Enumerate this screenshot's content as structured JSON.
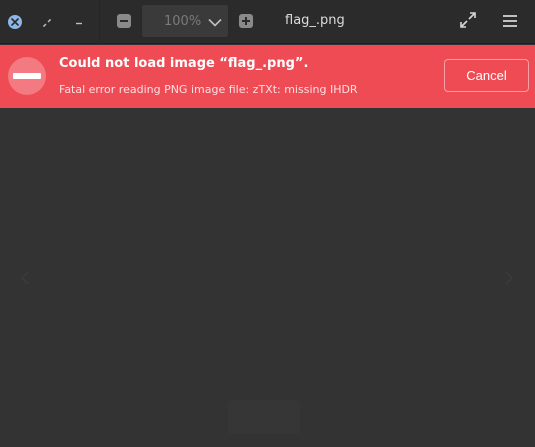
{
  "header": {
    "zoom_value": "100%",
    "title": "flag_.png"
  },
  "icons": {
    "close": "close-icon",
    "restore": "restore-icon",
    "minimize": "minimize-icon",
    "zoom_out": "zoom-out-icon",
    "zoom_dropdown": "chevron-down-icon",
    "zoom_in": "zoom-in-icon",
    "fullscreen": "fullscreen-icon",
    "menu": "hamburger-menu-icon",
    "error": "error-icon",
    "prev": "chevron-left-icon",
    "next": "chevron-right-icon"
  },
  "banner": {
    "title": "Could not load image “flag_.png”.",
    "detail": "Fatal error reading PNG image file: zTXt: missing IHDR",
    "cancel_label": "Cancel"
  },
  "colors": {
    "banner": "#ef4b54",
    "headerbar": "#2b2b2b",
    "viewer": "#333333",
    "close_accent": "#8fb7e6"
  }
}
